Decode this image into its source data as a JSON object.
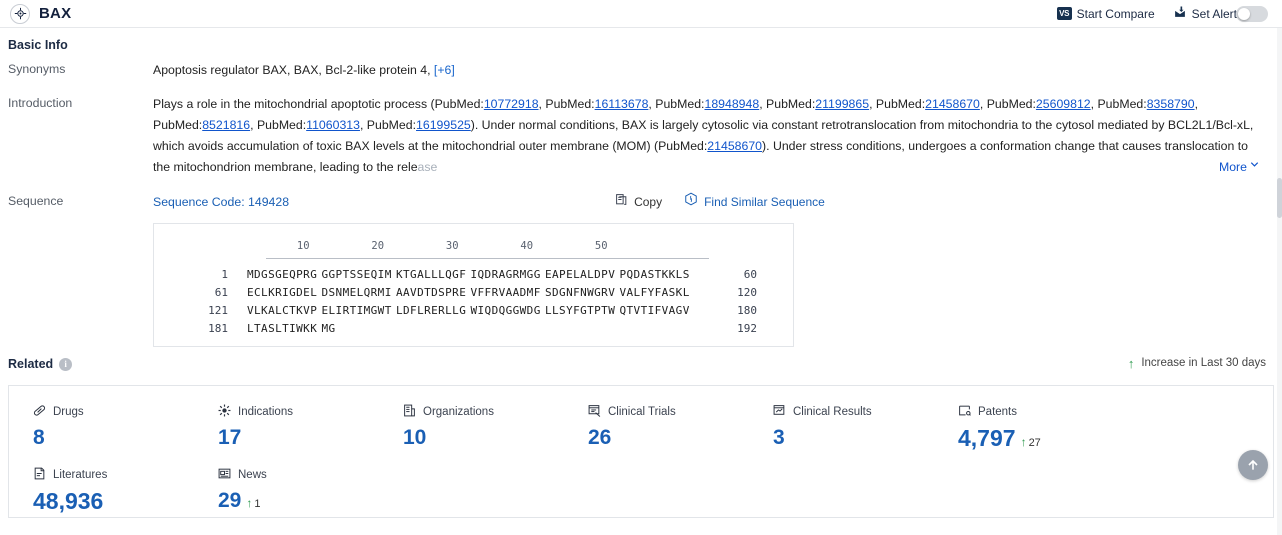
{
  "header": {
    "title": "BAX",
    "brand_icon": "target-icon",
    "start_compare": "Start Compare",
    "vs_badge": "VS",
    "set_alert": "Set Alert",
    "alert_icon": "alert-bell-icon",
    "toggle_state": "off"
  },
  "basic_info": {
    "section_label": "Basic Info",
    "synonyms": {
      "label": "Synonyms",
      "value": "Apoptosis regulator BAX,  BAX,  Bcl-2-like protein 4,",
      "more_count": "[+6]"
    },
    "introduction": {
      "label": "Introduction",
      "part1": "Plays a role in the mitochondrial apoptotic process (PubMed:",
      "pubmed_ids_line1": [
        "10772918",
        "16113678",
        "18948948",
        "21199865",
        "21458670",
        "25609812",
        "8358790",
        "8521816"
      ],
      "pubmed_ids_line2": [
        "11060313",
        "16199525"
      ],
      "text_line2": "). Under normal conditions, BAX is largely cytosolic via constant retrotranslocation from mitochondria to the cytosol mediated by BCL2L1/Bcl-xL, which avoids accumulation of toxic",
      "text_line3_a": "BAX levels at the mitochondrial outer membrane (MOM) (PubMed:",
      "pubmed_line3": "21458670",
      "text_line3_b": "). Under stress conditions, undergoes a conformation change that causes translocation to the mitochondrion membrane, leading to the rele",
      "tail_faded": "ase",
      "more_label": "More",
      "more_icon": "chevron-down-icon",
      "separator": ", PubMed:"
    },
    "sequence": {
      "label": "Sequence",
      "code_label": "Sequence Code: 149428",
      "copy_label": "Copy",
      "copy_icon": "copy-icon",
      "find_similar_label": "Find Similar Sequence",
      "find_similar_icon": "find-similar-icon",
      "ruler": [
        "10",
        "20",
        "30",
        "40",
        "50"
      ],
      "lines": [
        {
          "start": "1",
          "chunks": [
            "MDGSGEQPRG",
            "GGPTSSEQIM",
            "KTGALLLQGF",
            "IQDRAGRMGG",
            "EAPELALDPV",
            "PQDASTKKLS"
          ],
          "end": "60"
        },
        {
          "start": "61",
          "chunks": [
            "ECLKRIGDEL",
            "DSNMELQRMI",
            "AAVDTDSPRE",
            "VFFRVAADMF",
            "SDGNFNWGRV",
            "VALFYFASKL"
          ],
          "end": "120"
        },
        {
          "start": "121",
          "chunks": [
            "VLKALCTKVP",
            "ELIRTIMGWT",
            "LDFLRERLLG",
            "WIQDQGGWDG",
            "LLSYFGTPTW",
            "QTVTIFVAGV"
          ],
          "end": "180"
        },
        {
          "start": "181",
          "chunks": [
            "LTASLTIWKK",
            "MG"
          ],
          "end": "192"
        }
      ]
    }
  },
  "related": {
    "section_label": "Related",
    "info_icon": "info-icon",
    "info_glyph": "i",
    "legend": {
      "arrow_icon": "up-arrow-icon",
      "arrow_glyph": "↑",
      "label": "Increase in Last 30 days"
    },
    "stats": [
      {
        "icon": "drug-pill-icon",
        "label": "Drugs",
        "value": "8"
      },
      {
        "icon": "indications-icon",
        "label": "Indications",
        "value": "17"
      },
      {
        "icon": "organizations-icon",
        "label": "Organizations",
        "value": "10"
      },
      {
        "icon": "clinical-trials-icon",
        "label": "Clinical Trials",
        "value": "26"
      },
      {
        "icon": "clinical-results-icon",
        "label": "Clinical Results",
        "value": "3"
      },
      {
        "icon": "patents-icon",
        "label": "Patents",
        "value": "4,797",
        "delta": "27"
      },
      {
        "icon": "literatures-icon",
        "label": "Literatures",
        "value": "48,936"
      },
      {
        "icon": "news-icon",
        "label": "News",
        "value": "29",
        "delta": "1"
      }
    ]
  },
  "scroll_top": {
    "icon": "arrow-up-circle-icon",
    "glyph": "↑"
  },
  "colors": {
    "accent_blue": "#1a5fb4",
    "link_blue": "#1155cc",
    "green": "#2e9b4f",
    "dark_navy": "#14213d"
  }
}
